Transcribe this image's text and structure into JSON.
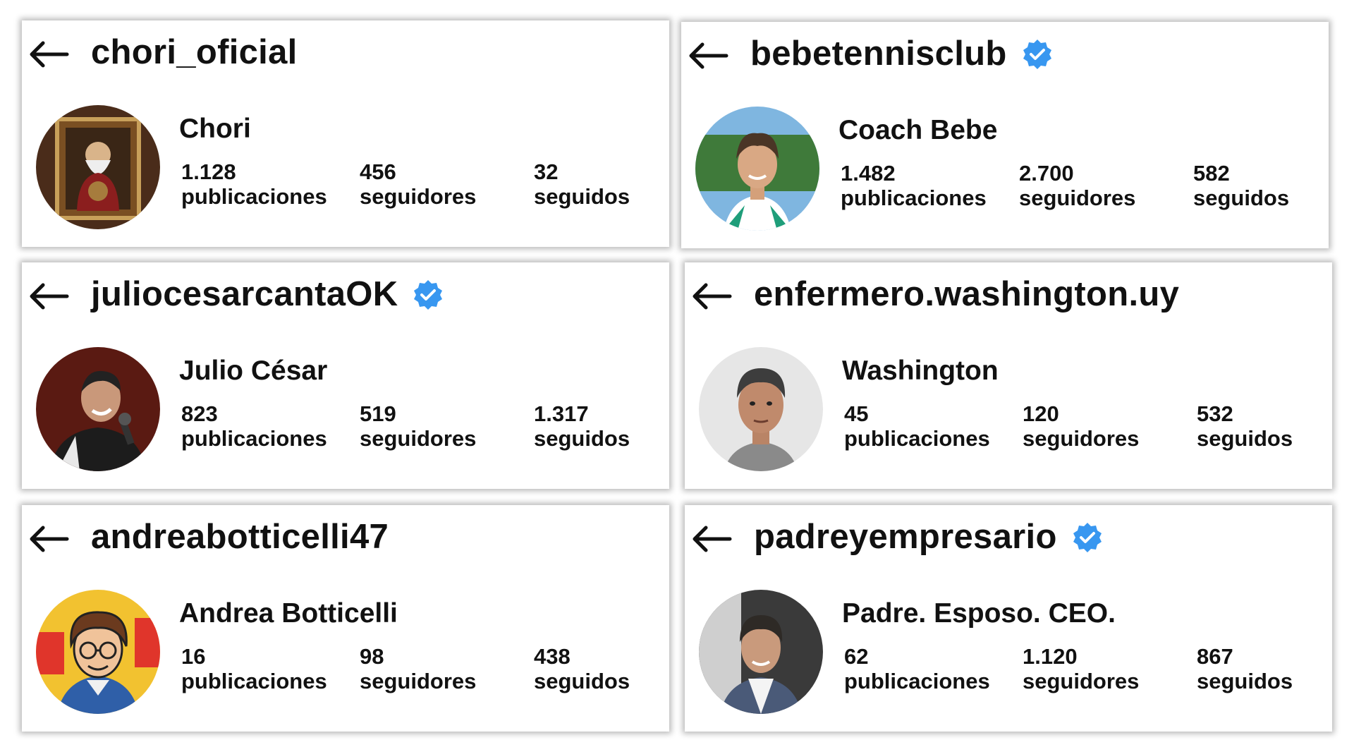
{
  "accent": {
    "verified_blue": "#3897f0"
  },
  "profiles": [
    {
      "username": "chori_oficial",
      "verified": false,
      "display_name": "Chori",
      "avatar": "painting-portrait",
      "stats": [
        {
          "value": "1.128",
          "label": "publicaciones"
        },
        {
          "value": "456",
          "label": "seguidores"
        },
        {
          "value": "32",
          "label": "seguidos"
        }
      ]
    },
    {
      "username": "bebetennisclub",
      "verified": true,
      "display_name": "Coach Bebe",
      "avatar": "tennis-coach-photo",
      "stats": [
        {
          "value": "1.482",
          "label": "publicaciones"
        },
        {
          "value": "2.700",
          "label": "seguidores"
        },
        {
          "value": "582",
          "label": "seguidos"
        }
      ]
    },
    {
      "username": "juliocesarcantaOK",
      "verified": true,
      "display_name": "Julio César",
      "avatar": "singer-photo",
      "stats": [
        {
          "value": "823",
          "label": "publicaciones"
        },
        {
          "value": "519",
          "label": "seguidores"
        },
        {
          "value": "1.317",
          "label": "seguidos"
        }
      ]
    },
    {
      "username": "enfermero.washington.uy",
      "verified": false,
      "display_name": "Washington",
      "avatar": "headshot-photo",
      "stats": [
        {
          "value": "45",
          "label": "publicaciones"
        },
        {
          "value": "120",
          "label": "seguidores"
        },
        {
          "value": "532",
          "label": "seguidos"
        }
      ]
    },
    {
      "username": "andreabotticelli47",
      "verified": false,
      "display_name": "Andrea Botticelli",
      "avatar": "cartoon-portrait",
      "stats": [
        {
          "value": "16",
          "label": "publicaciones"
        },
        {
          "value": "98",
          "label": "seguidores"
        },
        {
          "value": "438",
          "label": "seguidos"
        }
      ]
    },
    {
      "username": "padreyempresario",
      "verified": true,
      "display_name": "Padre. Esposo. CEO.",
      "avatar": "businessman-photo",
      "stats": [
        {
          "value": "62",
          "label": "publicaciones"
        },
        {
          "value": "1.120",
          "label": "seguidores"
        },
        {
          "value": "867",
          "label": "seguidos"
        }
      ]
    }
  ]
}
